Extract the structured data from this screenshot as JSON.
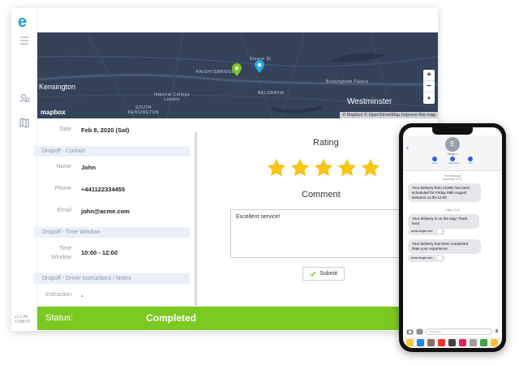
{
  "app": {
    "logo": "e",
    "version": "v1.0.8b\n#1d8f1f2"
  },
  "map": {
    "labels": {
      "kensington": "Kensington",
      "knightsbridge": "KNIGHTSBRIDGE",
      "belgravia": "BELGRAVIA",
      "westminster": "Westminster",
      "south_kensington": "SOUTH\nKENSINGTON",
      "imperial_college": "Imperial College\nLondon",
      "buckingham_palace": "Buckingham Palace",
      "sloane_sq": "Sloane St"
    },
    "zoom_in": "+",
    "zoom_out": "−",
    "compass": "▲",
    "brand": "mapbox",
    "attribution": "© Mapbox © OpenStreetMap  Improve this map"
  },
  "details": {
    "date_label": "Date",
    "date_value": "Feb 8, 2020 (Sat)",
    "contact_header": "Dropoff - Contact",
    "name_label": "Name",
    "name_value": "John",
    "phone_label": "Phone",
    "phone_value": "+441122334455",
    "email_label": "Email",
    "email_value": "john@acme.com",
    "time_header": "Dropoff - Time Window",
    "time_label": "Time\nWindow",
    "time_value": "10:00 - 12:00",
    "instructions_header": "Dropoff - Driver Instructions / Notes",
    "instruction_label": "Instruction",
    "instruction_value": "-"
  },
  "feedback": {
    "rating_title": "Rating",
    "rating_value": 5,
    "rating_max": 5,
    "comment_title": "Comment",
    "comment_text": "Excellent service!",
    "submit_label": "Submit"
  },
  "status": {
    "label": "Status:",
    "value": "Completed",
    "color": "#7bc820"
  },
  "phone": {
    "contact_initial": "E",
    "contact_name": "ecogo >",
    "actions": [
      "audio",
      "FaceTime",
      "info"
    ],
    "meta_1": "Text Message\nYesterday 10:11",
    "bubble_1": "Your delivery from ACME has been scheduled for Friday 09th August between 11:00-12:00",
    "meta_2": "Today 10:11",
    "bubble_2": "Your delivery is on the way! Track here:",
    "link_1": "acme.eingel.com",
    "bubble_3": "Your delivery has been completed. Rate your experience:",
    "link_2": "acme.eingel.com",
    "input_placeholder": "iMessage"
  },
  "colors": {
    "accent": "#1aa3d9",
    "star": "#f5c518",
    "status_green": "#7bc820",
    "map_bg": "#34425a",
    "pin_green": "#7bc820",
    "pin_blue": "#29a8e0"
  }
}
